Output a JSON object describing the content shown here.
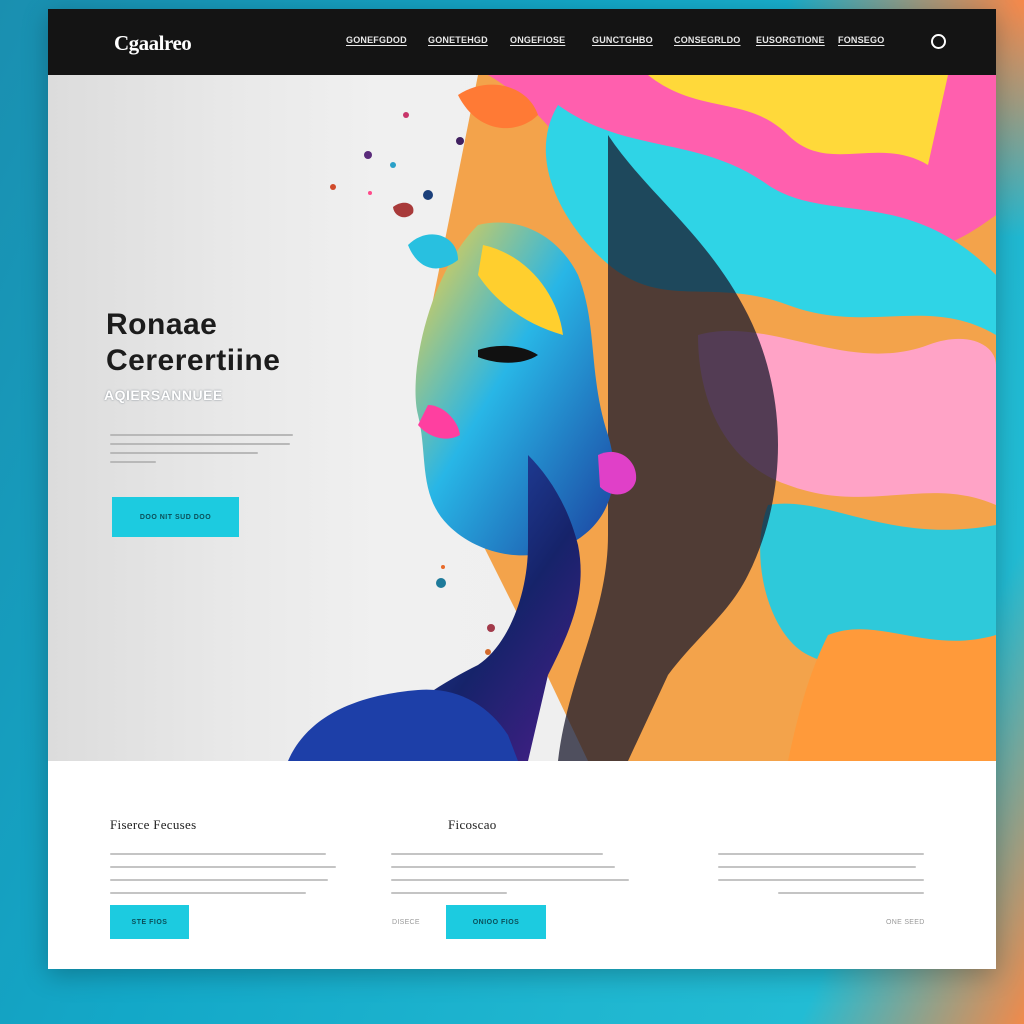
{
  "brand": {
    "logo": "Cgaalreo"
  },
  "nav": {
    "links": [
      "GONEFGDOD",
      "GONETEHGD",
      "ONGEFIOSE",
      "GUNCTGHBO",
      "CONSEGRLDO",
      "EUSORGTIONE",
      "FONSEGO"
    ],
    "search_icon": "search-icon"
  },
  "hero": {
    "title_line1": "Ronaae",
    "title_line2": "Cererertiine",
    "subtitle": "AQIERSANNUEE",
    "cta_label": "DOO NIT SUD DOO"
  },
  "features": [
    {
      "title": "Fiserce Fecuses",
      "button_label": "STE FIOS",
      "link": ""
    },
    {
      "title": "Ficoscao",
      "button_label": "ONIOO FIOS",
      "link": "DISECE"
    },
    {
      "title": "",
      "button_label": "",
      "link": "ONE SEED"
    }
  ],
  "colors": {
    "accent": "#1ccbe0",
    "navbar": "#141414",
    "background": "#13a8c8",
    "warm_corner": "#f08a4b"
  }
}
